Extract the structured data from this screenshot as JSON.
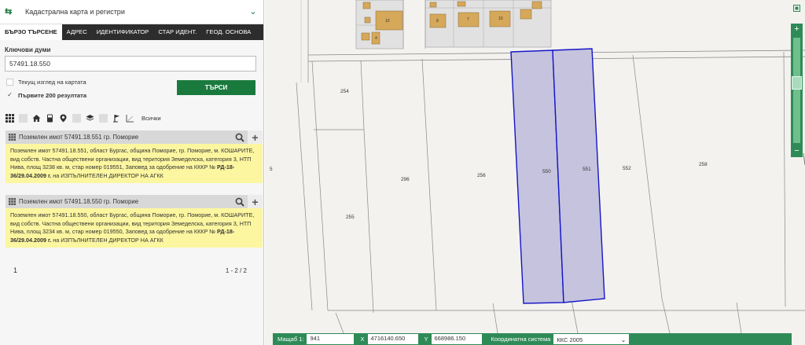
{
  "header": {
    "title": "Кадастрална карта и регистри",
    "logo": "cadastre-logo-icon",
    "chevron": "chevron-down-icon"
  },
  "tabs": [
    {
      "label": "БЪРЗО ТЪРСЕНЕ",
      "active": true
    },
    {
      "label": "АДРЕС"
    },
    {
      "label": "ИДЕНТИФИКАТОР"
    },
    {
      "label": "СТАР ИДЕНТ."
    },
    {
      "label": "ГЕОД. ОСНОВА"
    }
  ],
  "search": {
    "keywords_label": "Ключови думи",
    "keywords_value": "57491.18.550",
    "current_view_label": "Текущ изглед на картата",
    "first_200_label": "Първите 200 резултата",
    "first_200_checked": true,
    "button_label": "ТЪРСИ"
  },
  "filters": {
    "icons": [
      "grid-icon",
      "building-icon",
      "home-icon",
      "meter-icon",
      "pin-icon",
      "blank-icon",
      "layers-icon",
      "blank-icon",
      "flag-icon",
      "survey-icon"
    ],
    "all_label": "Всички"
  },
  "results": [
    {
      "title": "Поземлен имот 57491.18.551 гр. Поморие",
      "body_pre": "Поземлен имот 57491.18.551, област Бургас, община Поморие, гр. Поморие, м. КОШАРИТЕ, вид собств. Частна обществени организации, вид територия Земеделска, категория 3, НТП Нива, площ 3238 кв. м, стар номер 019551, Заповед за одобрение на КККР №",
      "body_bold": "РД-18-36/29.04.2009 г.",
      "body_post": "на ИЗПЪЛНИТЕЛЕН ДИРЕКТОР НА АГКК"
    },
    {
      "title": "Поземлен имот 57491.18.550 гр. Поморие",
      "body_pre": "Поземлен имот 57491.18.550, област Бургас, община Поморие, гр. Поморие, м. КОШАРИТЕ, вид собств. Частна обществени организации, вид територия Земеделска, категория 3, НТП Нива, площ 3234 кв. м, стар номер 019550, Заповед за одобрение на КККР №",
      "body_bold": "РД-18-36/29.04.2009 г.",
      "body_post": "на ИЗПЪЛНИТЕЛЕН ДИРЕКТОР НА АГКК"
    }
  ],
  "pager": {
    "page": "1",
    "count": "1 - 2 / 2"
  },
  "map": {
    "parcel_labels": [
      "254",
      "296",
      "256",
      "550",
      "551",
      "552",
      "258",
      "255",
      "5"
    ],
    "building_labels": [
      "10",
      "8",
      "7",
      "10",
      "4"
    ],
    "highlight_color": "#c5c3de",
    "highlight_stroke": "#1515c8"
  },
  "statusbar": {
    "scale_label": "Мащаб  1:",
    "scale_value": "941",
    "x_label": "X",
    "x_value": "4716140.650",
    "y_label": "Y",
    "y_value": "668986.150",
    "crs_label": "Координатна система",
    "crs_value": "ККС 2005"
  },
  "colors": {
    "accent": "#1a7a3e",
    "result_bg": "#fcf6a0",
    "building": "#d6a85a"
  }
}
